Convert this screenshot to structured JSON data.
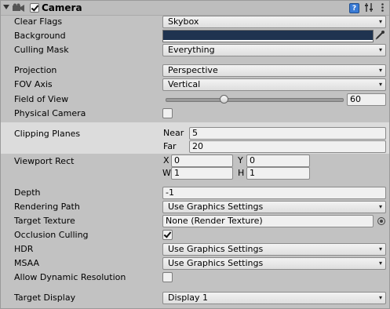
{
  "component": {
    "title": "Camera",
    "enabled": true,
    "help_glyph": "?"
  },
  "fields": {
    "clear_flags": {
      "label": "Clear Flags",
      "value": "Skybox"
    },
    "background": {
      "label": "Background",
      "color": "#1f3350"
    },
    "culling_mask": {
      "label": "Culling Mask",
      "value": "Everything"
    },
    "projection": {
      "label": "Projection",
      "value": "Perspective"
    },
    "fov_axis": {
      "label": "FOV Axis",
      "value": "Vertical"
    },
    "field_of_view": {
      "label": "Field of View",
      "value": "60",
      "slider_fraction": 0.33
    },
    "physical_camera": {
      "label": "Physical Camera",
      "checked": false
    },
    "clipping_planes": {
      "label": "Clipping Planes",
      "near_label": "Near",
      "near_value": "5",
      "far_label": "Far",
      "far_value": "20"
    },
    "viewport_rect": {
      "label": "Viewport Rect",
      "x_label": "X",
      "x_value": "0",
      "y_label": "Y",
      "y_value": "0",
      "w_label": "W",
      "w_value": "1",
      "h_label": "H",
      "h_value": "1"
    },
    "depth": {
      "label": "Depth",
      "value": "-1"
    },
    "rendering_path": {
      "label": "Rendering Path",
      "value": "Use Graphics Settings"
    },
    "target_texture": {
      "label": "Target Texture",
      "value": "None (Render Texture)"
    },
    "occlusion_culling": {
      "label": "Occlusion Culling",
      "checked": true
    },
    "hdr": {
      "label": "HDR",
      "value": "Use Graphics Settings"
    },
    "msaa": {
      "label": "MSAA",
      "value": "Use Graphics Settings"
    },
    "allow_dynamic_resolution": {
      "label": "Allow Dynamic Resolution",
      "checked": false
    },
    "target_display": {
      "label": "Target Display",
      "value": "Display 1"
    }
  },
  "icons": {
    "foldout": "triangle-down",
    "camera": "camera-icon",
    "help": "help-icon",
    "preset": "sliders-icon",
    "menu": "kebab-menu-icon",
    "dropdown": "▾",
    "eyedropper": "eyedropper-icon",
    "object_picker": "object-picker-icon"
  },
  "colors": {
    "panel_bg": "#c2c2c2",
    "highlight_bg": "#dcdcdc",
    "help_blue": "#3a7bd5"
  }
}
